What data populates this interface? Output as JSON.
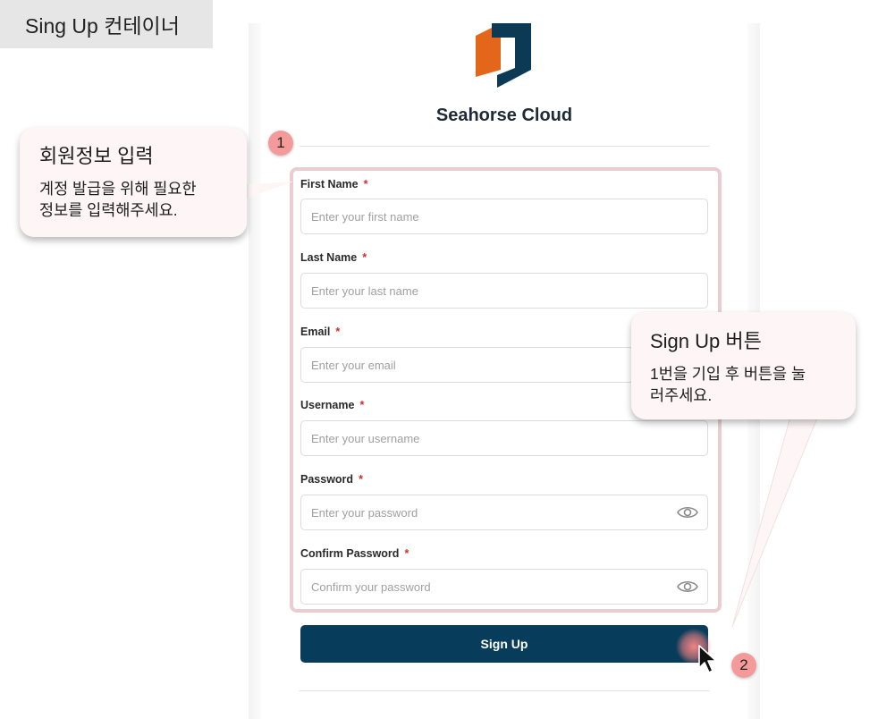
{
  "tag": {
    "label": "Sing Up 컨테이너"
  },
  "brand": {
    "name": "Seahorse Cloud",
    "logo_icon": "seahorse-cloud-logo",
    "colors": {
      "orange": "#e3661a",
      "navy": "#0c3a55"
    }
  },
  "form": {
    "fields": [
      {
        "label": "First Name",
        "required_mark": "*",
        "placeholder": "Enter your first name"
      },
      {
        "label": "Last Name",
        "required_mark": "*",
        "placeholder": "Enter your last name"
      },
      {
        "label": "Email",
        "required_mark": "*",
        "placeholder": "Enter your email"
      },
      {
        "label": "Username",
        "required_mark": "*",
        "placeholder": "Enter your username"
      },
      {
        "label": "Password",
        "required_mark": "*",
        "placeholder": "Enter your password",
        "icon": "eye-icon"
      },
      {
        "label": "Confirm Password",
        "required_mark": "*",
        "placeholder": "Confirm your password",
        "icon": "eye-icon"
      }
    ],
    "submit_label": "Sign Up"
  },
  "annotations": [
    {
      "number": "1",
      "title": "회원정보 입력",
      "lines": [
        "계정 발급을 위해 필요한",
        "정보를 입력해주세요."
      ]
    },
    {
      "number": "2",
      "title": "Sign Up  버튼",
      "lines": [
        "1번을 기입 후 버튼을 눌",
        "러주세요."
      ]
    }
  ],
  "colors": {
    "accent_button": "#073d5a",
    "highlight_border": "#e9cdd2",
    "badge": "#f49a9a",
    "required": "#d42b2b"
  }
}
